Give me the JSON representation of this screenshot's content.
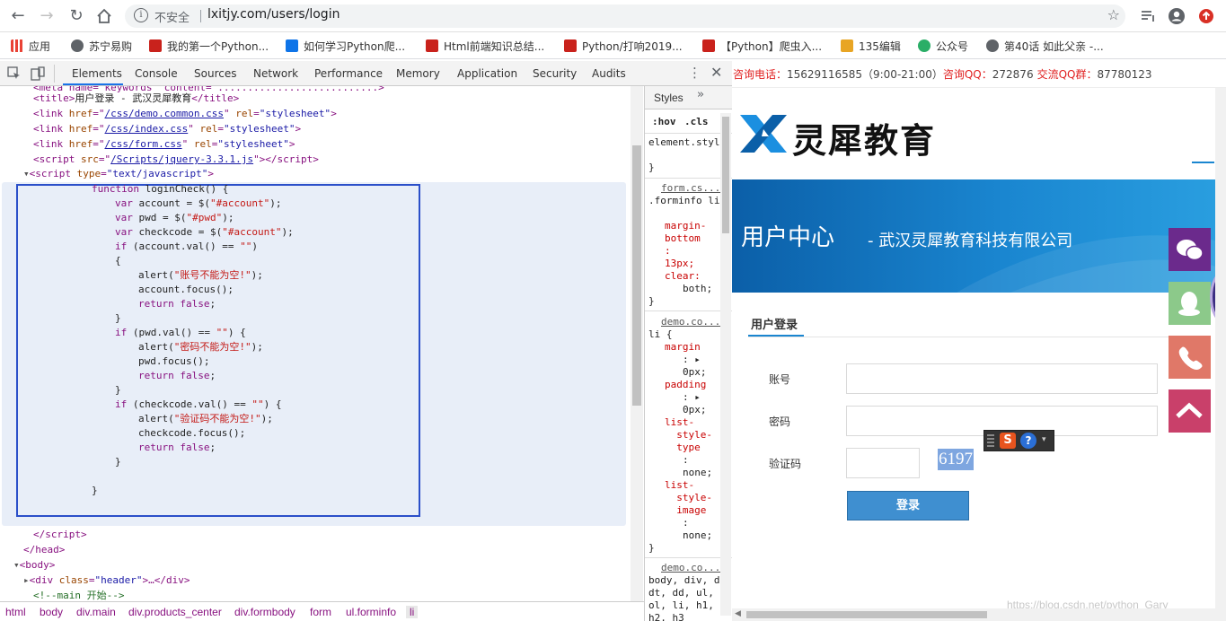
{
  "browser": {
    "insecure_label": "不安全",
    "url": "lxitjy.com/users/login",
    "bookmarks": [
      {
        "label": "应用"
      },
      {
        "label": "苏宁易购"
      },
      {
        "label": "我的第一个Python..."
      },
      {
        "label": "如何学习Python爬..."
      },
      {
        "label": "Html前端知识总结..."
      },
      {
        "label": "Python/打响2019..."
      },
      {
        "label": "【Python】爬虫入..."
      },
      {
        "label": "135编辑"
      },
      {
        "label": "公众号"
      },
      {
        "label": "第40话 如此父亲 -..."
      }
    ]
  },
  "devtools": {
    "tabs": [
      "Elements",
      "Console",
      "Sources",
      "Network",
      "Performance",
      "Memory",
      "Application",
      "Security",
      "Audits"
    ],
    "active_tab": "Elements",
    "styles_tab": "Styles",
    "hov": ":hov",
    "cls": ".cls",
    "code": {
      "title_open": "<title>",
      "title_text": "用户登录 - 武汉灵犀教育",
      "title_close": "</title>",
      "link1": "/css/demo.common.css",
      "link2": "/css/index.css",
      "link3": "/css/form.css",
      "script_src": "/Scripts/jquery-3.3.1.js",
      "js": [
        "function loginCheck() {",
        "var account = $(\"#account\");",
        "var pwd = $(\"#pwd\");",
        "var checkcode = $(\"#account\");",
        "if (account.val() == \"\")",
        "{",
        "alert(\"账号不能为空!\");",
        "account.focus();",
        "return false;",
        "}",
        "if (pwd.val() == \"\") {",
        "alert(\"密码不能为空!\");",
        "pwd.focus();",
        "return false;",
        "}",
        "if (checkcode.val() == \"\") {",
        "alert(\"验证码不能为空!\");",
        "checkcode.focus();",
        "return false;",
        "}",
        "}"
      ],
      "comment": "<!--main 开始-->"
    },
    "styles": {
      "element_style": "element.style {",
      "rule1_src": "form.cs...",
      "rule1_sel": ".forminfo li {",
      "rule1_props": [
        "margin-bottom: 13px;",
        "clear: both;"
      ],
      "rule2_src": "demo.co...",
      "rule2_sel": "li {",
      "rule2_props": [
        "margin: ▶ 0px;",
        "padding: ▶ 0px;",
        "list-style-type: none;",
        "list-style-image: none;"
      ],
      "rule3_src": "demo.co...",
      "rule3_sel": "body, div, dl, dt, dd, ul, ol, li, h1, h2, h3"
    },
    "breadcrumb": [
      "html",
      "body",
      "div.main",
      "div.products_center",
      "div.formbody",
      "form",
      "ul.forminfo",
      "li"
    ]
  },
  "page": {
    "contact": {
      "phone_label": "咨询电话：",
      "phone": "15629116585（9:00-21:00）",
      "qq_label": "咨询QQ：",
      "qq": "272876",
      "group_label": "交流QQ群：",
      "group": "87780123"
    },
    "logo_text": "灵犀教育",
    "banner_title": "用户中心",
    "banner_sub": "- 武汉灵犀教育科技有限公司",
    "login_tab": "用户登录",
    "account_label": "账号",
    "password_label": "密码",
    "captcha_label": "验证码",
    "captcha_value": "6197",
    "login_button": "登录",
    "watermark": "https://blog.csdn.net/python_Gary"
  }
}
